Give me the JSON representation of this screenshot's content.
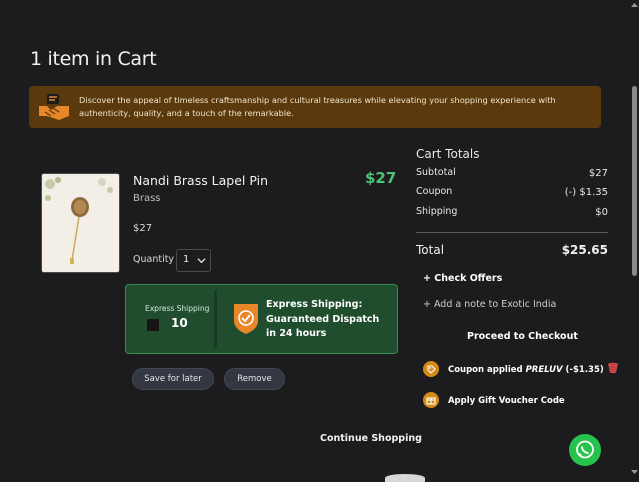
{
  "page": {
    "title": "1 item in Cart",
    "banner_text": "Discover the appeal of timeless craftsmanship and cultural treasures while elevating your shopping experience with authenticity, quality, and a touch of the remarkable."
  },
  "item": {
    "name": "Nandi Brass Lapel Pin",
    "price": "$27",
    "material": "Brass",
    "unit_price": "$27",
    "quantity_label": "Quantity",
    "quantity_value": "1",
    "save_label": "Save for later",
    "remove_label": "Remove"
  },
  "express": {
    "small_label": "Express Shipping",
    "days": "10",
    "title": "Express Shipping: Guaranteed Dispatch in 24 hours",
    "checked": false
  },
  "totals": {
    "title": "Cart Totals",
    "rows": [
      {
        "label": "Subtotal",
        "value": "$27"
      },
      {
        "label": "Coupon",
        "value": "(-) $1.35"
      },
      {
        "label": "Shipping",
        "value": "$0"
      }
    ],
    "total_label": "Total",
    "total_value": "$25.65",
    "check_offers": "+ Check Offers",
    "add_note": "+ Add a note to Exotic India",
    "checkout": "Proceed to Checkout",
    "coupon_prefix": "Coupon applied ",
    "coupon_code": "PRELUV",
    "coupon_suffix": " (-$1.35)",
    "gift_voucher": "Apply Gift Voucher Code"
  },
  "footer": {
    "continue": "Continue Shopping"
  },
  "colors": {
    "price_green": "#4fc27a",
    "banner_bg": "#5a3a0c",
    "express_bg": "#1f4d2d",
    "accent_orange": "#d48a16",
    "whatsapp_green": "#27c24c"
  },
  "icons": [
    "handshake-icon",
    "chevron-down-icon",
    "shield-check-icon",
    "tag-icon",
    "trash-icon",
    "gift-icon",
    "whatsapp-icon"
  ]
}
